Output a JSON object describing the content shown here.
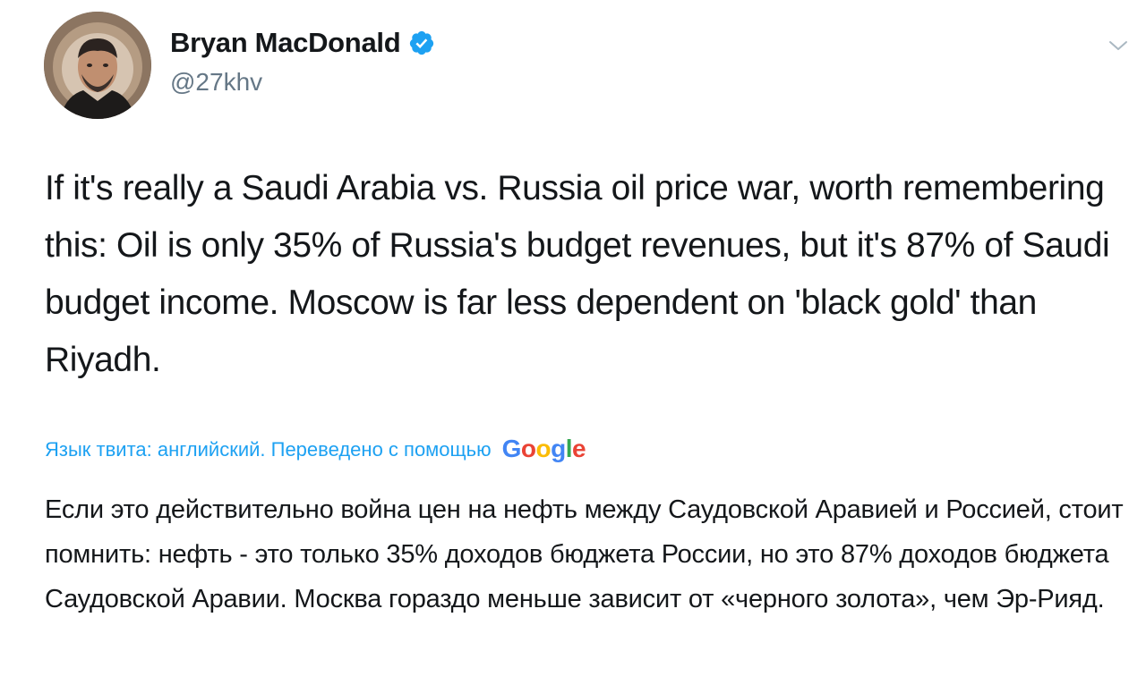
{
  "author": {
    "name": "Bryan MacDonald",
    "handle": "@27khv",
    "verified": true
  },
  "tweet": {
    "text": "If it's really a Saudi Arabia vs. Russia oil price war, worth remembering this: Oil is only 35% of Russia's budget revenues, but it's 87% of Saudi budget income. Moscow is far less dependent on 'black gold' than Riyadh."
  },
  "translation": {
    "label": "Язык твита: английский. Переведено с помощью",
    "provider": "Google",
    "text": "Если это действительно война цен на нефть между Саудовской Аравией и Россией, стоит помнить: нефть - это только 35% доходов бюджета России, но это 87% доходов бюджета Саудовской Аравии. Москва гораздо меньше зависит от «черного золота», чем Эр-Рияд."
  },
  "icons": {
    "verified": "verified-badge-icon",
    "menu": "chevron-down-icon"
  },
  "colors": {
    "accent": "#1da1f2",
    "text": "#14171a",
    "secondary": "#657786",
    "google_blue": "#4285F4",
    "google_red": "#EA4335",
    "google_yellow": "#FBBC05",
    "google_green": "#34A853"
  }
}
